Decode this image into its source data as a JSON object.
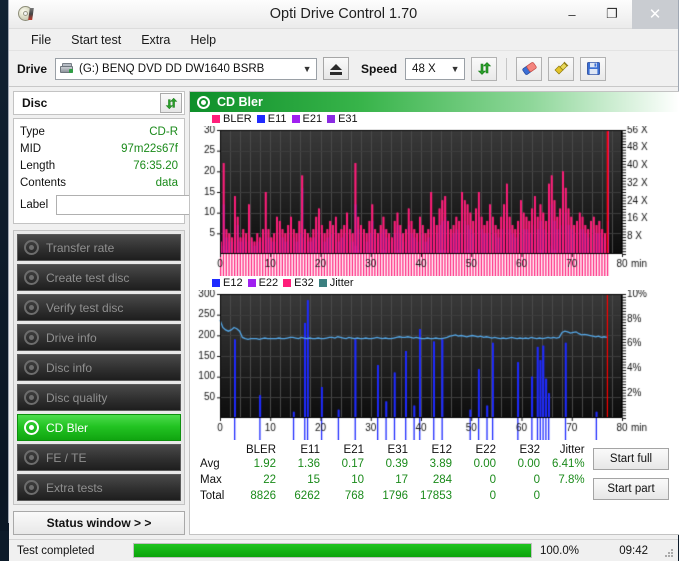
{
  "window": {
    "title": "Opti Drive Control 1.70",
    "icon": "cd-disc-icon",
    "minimize": "–",
    "maximize": "❐",
    "close": "✕"
  },
  "menu": [
    "File",
    "Start test",
    "Extra",
    "Help"
  ],
  "toolbar": {
    "drive_label": "Drive",
    "drive_value": "(G:)   BENQ DVD DD DW1640 BSRB",
    "drive_icon": "hdd-icon",
    "eject_icon": "eject-icon",
    "speed_label": "Speed",
    "speed_value": "48 X",
    "refresh_icon": "refresh-arrows-icon",
    "eraser_icon": "eraser-icon",
    "plug_icon": "plug-icon",
    "save_icon": "floppy-save-icon"
  },
  "disc": {
    "header": "Disc",
    "refresh_icon": "refresh-arrows-icon",
    "fields": [
      {
        "key": "Type",
        "value": "CD-R"
      },
      {
        "key": "MID",
        "value": "97m22s67f"
      },
      {
        "key": "Length",
        "value": "76:35.20"
      },
      {
        "key": "Contents",
        "value": "data"
      }
    ],
    "label_key": "Label",
    "label_value": "",
    "label_placeholder": "",
    "label_button_icon": "cd-disc-icon"
  },
  "nav": {
    "items": [
      {
        "label": "Transfer rate",
        "active": false
      },
      {
        "label": "Create test disc",
        "active": false
      },
      {
        "label": "Verify test disc",
        "active": false
      },
      {
        "label": "Drive info",
        "active": false
      },
      {
        "label": "Disc info",
        "active": false
      },
      {
        "label": "Disc quality",
        "active": false
      },
      {
        "label": "CD Bler",
        "active": true
      },
      {
        "label": "FE / TE",
        "active": false
      },
      {
        "label": "Extra tests",
        "active": false
      }
    ],
    "status_window": "Status window > >"
  },
  "panel": {
    "title": "CD Bler",
    "icon": "cd-bler-icon"
  },
  "actions": {
    "start_full": "Start full",
    "start_part": "Start part"
  },
  "statusbar": {
    "text": "Test completed",
    "progress_pct_label": "100.0%",
    "progress_value": 100,
    "elapsed": "09:42"
  },
  "stats": {
    "columns": [
      "BLER",
      "E11",
      "E21",
      "E31",
      "E12",
      "E22",
      "E32",
      "Jitter"
    ],
    "rows": [
      {
        "label": "Avg",
        "values": [
          "1.92",
          "1.36",
          "0.17",
          "0.39",
          "3.89",
          "0.00",
          "0.00",
          "6.41%"
        ]
      },
      {
        "label": "Max",
        "values": [
          "22",
          "15",
          "10",
          "17",
          "284",
          "0",
          "0",
          "7.8%"
        ]
      },
      {
        "label": "Total",
        "values": [
          "8826",
          "6262",
          "768",
          "1796",
          "17853",
          "0",
          "0",
          ""
        ]
      }
    ]
  },
  "chart_data": [
    {
      "type": "area",
      "id": "bler-chart",
      "title": "CD Bler",
      "xlabel": "min",
      "ylabel": "",
      "xlim": [
        0,
        80
      ],
      "ylim": [
        0,
        30
      ],
      "y2lim": [
        0,
        60
      ],
      "xticks": [
        0,
        10,
        20,
        30,
        40,
        50,
        60,
        70,
        80
      ],
      "yticks": [
        5,
        10,
        15,
        20,
        25,
        30
      ],
      "y2ticks": [
        "8 X",
        "16 X",
        "24 X",
        "32 X",
        "40 X",
        "48 X",
        "56 X"
      ],
      "xtick_suffix": "min",
      "grid": true,
      "background": "#1a1a1a",
      "legend_position": "top-left",
      "legend": [
        {
          "name": "BLER",
          "color": "#ff1e7a"
        },
        {
          "name": "E11",
          "color": "#1f2bff"
        },
        {
          "name": "E21",
          "color": "#a020f0"
        },
        {
          "name": "E31",
          "color": "#8a2be2"
        }
      ],
      "data_end_x": 77,
      "speed_line_color": "#ff0000",
      "series": [
        {
          "name": "BLER",
          "color": "#ff1e7a",
          "values": [
            3,
            22,
            6,
            5,
            4,
            14,
            9,
            4,
            6,
            5,
            12,
            4,
            3,
            5,
            4,
            6,
            15,
            6,
            4,
            5,
            9,
            8,
            6,
            5,
            7,
            9,
            6,
            5,
            8,
            19,
            6,
            5,
            4,
            6,
            9,
            11,
            7,
            5,
            6,
            8,
            7,
            9,
            5,
            6,
            7,
            10,
            6,
            5,
            22,
            9,
            7,
            6,
            5,
            8,
            12,
            6,
            5,
            7,
            9,
            6,
            5,
            4,
            8,
            10,
            7,
            5,
            6,
            11,
            8,
            6,
            5,
            9,
            7,
            5,
            6,
            15,
            9,
            7,
            11,
            13,
            14,
            8,
            6,
            7,
            9,
            8,
            15,
            13,
            12,
            10,
            8,
            11,
            15,
            9,
            7,
            8,
            12,
            9,
            7,
            6,
            9,
            12,
            17,
            9,
            7,
            6,
            8,
            13,
            10,
            9,
            8,
            11,
            14,
            9,
            12,
            10,
            8,
            17,
            19,
            13,
            9,
            11,
            20,
            16,
            11,
            9,
            7,
            8,
            10,
            9,
            7,
            6,
            8,
            9,
            7,
            8,
            6,
            5,
            30
          ]
        },
        {
          "name": "E11",
          "color": "#1f2bff",
          "values": [
            2,
            12,
            4,
            3,
            3,
            9,
            7,
            3,
            4,
            3,
            8,
            3,
            2,
            3,
            3,
            4,
            6,
            4,
            3,
            3,
            6,
            5,
            4,
            3,
            5,
            6,
            4,
            3,
            5,
            16,
            4,
            3,
            3,
            4,
            6,
            7,
            5,
            3,
            4,
            5,
            5,
            6,
            3,
            4,
            5,
            7,
            4,
            3,
            12,
            6,
            5,
            4,
            3,
            5,
            8,
            4,
            3,
            5,
            6,
            4,
            3,
            3,
            5,
            7,
            5,
            3,
            4,
            7,
            5,
            4,
            3,
            6,
            5,
            3,
            4,
            9,
            6,
            5,
            7,
            8,
            9,
            5,
            4,
            5,
            6,
            5,
            9,
            8,
            7,
            6,
            5,
            7,
            9,
            6,
            5,
            5,
            8,
            6,
            5,
            4,
            6,
            8,
            11,
            6,
            5,
            4,
            5,
            8,
            6,
            6,
            5,
            7,
            9,
            6,
            8,
            6,
            5,
            11,
            12,
            8,
            6,
            7,
            12,
            10,
            7,
            6,
            5,
            5,
            6,
            6,
            5,
            4,
            5,
            6,
            5,
            5,
            4,
            3,
            8
          ]
        },
        {
          "name": "E21",
          "color": "#a020f0",
          "values": [
            0,
            2,
            1,
            0,
            0,
            1,
            1,
            0,
            0,
            0,
            1,
            0,
            0,
            0,
            0,
            0,
            1,
            0,
            0,
            0,
            0,
            1,
            0,
            0,
            0,
            1,
            0,
            0,
            0,
            4,
            0,
            0,
            0,
            0,
            1,
            1,
            0,
            0,
            0,
            0,
            0,
            1,
            0,
            0,
            0,
            1,
            0,
            0,
            2,
            1,
            0,
            0,
            0,
            0,
            1,
            0,
            0,
            0,
            1,
            0,
            0,
            0,
            0,
            1,
            0,
            0,
            0,
            1,
            0,
            0,
            0,
            1,
            0,
            0,
            0,
            1,
            1,
            0,
            1,
            1,
            1,
            0,
            0,
            0,
            1,
            0,
            1,
            1,
            1,
            0,
            0,
            1,
            1,
            0,
            0,
            0,
            1,
            0,
            0,
            0,
            0,
            1,
            2,
            0,
            0,
            0,
            0,
            1,
            0,
            0,
            0,
            1,
            1,
            0,
            1,
            0,
            0,
            2,
            2,
            1,
            0,
            1,
            2,
            1,
            0,
            0,
            0,
            0,
            0,
            0,
            0,
            0,
            0,
            0,
            0,
            0,
            0,
            0,
            1
          ]
        },
        {
          "name": "E31",
          "color": "#8a2be2",
          "values": [
            0,
            0,
            0,
            0,
            0,
            0,
            0,
            0,
            0,
            0,
            0,
            0,
            0,
            0,
            0,
            0,
            0,
            0,
            0,
            0,
            0,
            0,
            0,
            0,
            0,
            0,
            0,
            0,
            0,
            1,
            0,
            0,
            0,
            0,
            0,
            0,
            0,
            0,
            0,
            0,
            0,
            0,
            0,
            0,
            0,
            0,
            0,
            0,
            1,
            0,
            0,
            0,
            0,
            0,
            0,
            0,
            0,
            0,
            0,
            0,
            0,
            0,
            0,
            0,
            0,
            0,
            0,
            0,
            0,
            0,
            0,
            0,
            0,
            0,
            0,
            0,
            0,
            0,
            0,
            0,
            0,
            0,
            0,
            0,
            0,
            0,
            0,
            0,
            0,
            0,
            0,
            0,
            0,
            0,
            0,
            0,
            0,
            0,
            0,
            0,
            0,
            0,
            1,
            0,
            0,
            0,
            0,
            0,
            0,
            0,
            0,
            0,
            0,
            0,
            0,
            0,
            0,
            1,
            1,
            0,
            0,
            0,
            1,
            0,
            0,
            0,
            0,
            0,
            0,
            0,
            0,
            0,
            0,
            0,
            0,
            0,
            0,
            0,
            0
          ]
        }
      ]
    },
    {
      "type": "area",
      "id": "e12-jitter-chart",
      "title": "",
      "xlabel": "min",
      "ylabel": "",
      "xlim": [
        0,
        80
      ],
      "ylim": [
        0,
        300
      ],
      "y2lim": [
        0,
        10
      ],
      "xticks": [
        0,
        10,
        20,
        30,
        40,
        50,
        60,
        70,
        80
      ],
      "yticks": [
        50,
        100,
        150,
        200,
        250,
        300
      ],
      "y2ticks": [
        "2%",
        "4%",
        "6%",
        "8%",
        "10%"
      ],
      "xtick_suffix": "min",
      "grid": true,
      "background": "#1a1a1a",
      "legend_position": "top-left",
      "legend": [
        {
          "name": "E12",
          "color": "#1f2bff"
        },
        {
          "name": "E22",
          "color": "#a020f0"
        },
        {
          "name": "E32",
          "color": "#ff1e7a"
        },
        {
          "name": "Jitter",
          "color": "#3c8080"
        }
      ],
      "data_end_x": 77,
      "speed_line_color": "#ff0000",
      "series": [
        {
          "name": "E12",
          "color": "#1f2bff",
          "values": [
            0,
            0,
            0,
            0,
            0,
            190,
            0,
            0,
            0,
            0,
            0,
            0,
            0,
            0,
            55,
            0,
            0,
            0,
            0,
            0,
            0,
            0,
            0,
            0,
            0,
            0,
            15,
            0,
            0,
            0,
            230,
            285,
            0,
            0,
            0,
            0,
            75,
            0,
            0,
            0,
            0,
            0,
            20,
            0,
            0,
            0,
            0,
            0,
            190,
            0,
            0,
            0,
            0,
            0,
            0,
            0,
            128,
            0,
            0,
            40,
            0,
            0,
            110,
            0,
            0,
            0,
            162,
            0,
            0,
            30,
            0,
            215,
            0,
            0,
            0,
            0,
            185,
            0,
            0,
            190,
            0,
            0,
            0,
            0,
            0,
            0,
            0,
            0,
            0,
            20,
            0,
            0,
            118,
            0,
            0,
            30,
            0,
            182,
            0,
            0,
            0,
            0,
            0,
            0,
            0,
            0,
            135,
            0,
            0,
            0,
            0,
            100,
            0,
            172,
            140,
            175,
            95,
            60,
            0,
            0,
            0,
            0,
            0,
            182,
            0,
            0,
            0,
            0,
            0,
            0,
            0,
            0,
            0,
            0,
            15,
            0,
            0,
            0,
            0
          ]
        },
        {
          "name": "Jitter",
          "color": "#55a8e8",
          "axis": "right",
          "values": [
            7.9,
            7.3,
            7.1,
            7.0,
            7.1,
            7.3,
            7.2,
            7.0,
            6.5,
            6.4,
            6.35,
            6.4,
            6.4,
            6.4,
            6.35,
            6.4,
            6.45,
            6.4,
            6.4,
            6.4,
            6.4,
            6.45,
            6.4,
            6.4,
            6.45,
            6.5,
            6.5,
            6.45,
            6.4,
            6.5,
            6.45,
            6.4,
            6.45,
            6.4,
            6.4,
            6.45,
            6.4,
            6.4,
            6.45,
            6.5,
            6.5,
            6.45,
            6.55,
            6.5,
            6.45,
            6.4,
            6.5,
            6.45,
            6.4,
            6.45,
            6.4,
            6.4,
            6.45,
            6.4,
            6.4,
            6.45,
            6.5,
            6.45,
            6.4,
            6.45,
            6.4,
            6.4,
            6.45,
            6.5,
            6.55,
            6.5,
            6.5,
            6.55,
            6.5,
            6.45,
            6.5,
            6.45,
            6.4,
            6.4,
            6.45,
            6.4,
            6.4,
            6.45,
            6.4,
            6.4,
            6.45,
            6.5,
            6.6,
            6.65,
            6.7,
            6.6,
            6.65,
            6.6,
            6.55,
            6.6,
            6.65,
            6.6,
            6.55,
            6.6,
            6.5,
            6.55,
            6.5,
            6.45,
            6.5,
            6.45,
            6.4,
            6.45,
            6.4,
            6.45,
            6.5,
            6.45,
            6.4,
            6.45,
            6.4,
            6.45,
            6.4,
            6.5,
            6.45,
            6.4,
            6.45,
            6.4,
            6.45,
            6.5,
            6.45,
            6.5,
            6.45,
            6.5,
            6.9,
            7.0,
            6.95,
            6.85,
            6.9,
            6.95,
            6.8,
            6.7,
            6.75,
            6.7,
            6.65,
            6.6,
            6.55,
            6.6,
            6.5,
            6.55,
            6.5
          ]
        }
      ]
    }
  ]
}
